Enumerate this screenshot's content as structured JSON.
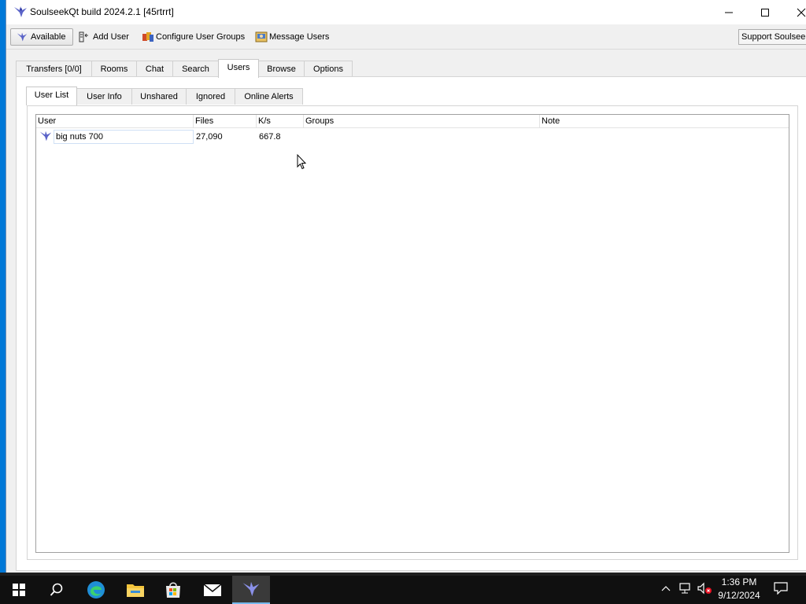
{
  "window": {
    "title": "SoulseekQt build 2024.2.1 [45rtrrt]"
  },
  "toolbar": {
    "status_label": "Available",
    "add_user_label": "Add User",
    "configure_groups_label": "Configure User Groups",
    "message_users_label": "Message Users",
    "support_label": "Support Soulseek"
  },
  "main_tabs": [
    {
      "label": "Transfers [0/0]"
    },
    {
      "label": "Rooms"
    },
    {
      "label": "Chat"
    },
    {
      "label": "Search"
    },
    {
      "label": "Users"
    },
    {
      "label": "Browse"
    },
    {
      "label": "Options"
    }
  ],
  "main_tabs_selected": "Users",
  "sub_tabs": [
    {
      "label": "User List"
    },
    {
      "label": "User Info"
    },
    {
      "label": "Unshared"
    },
    {
      "label": "Ignored"
    },
    {
      "label": "Online Alerts"
    }
  ],
  "sub_tabs_selected": "User List",
  "user_list": {
    "columns": [
      "User",
      "Files",
      "K/s",
      "Groups",
      "Note"
    ],
    "rows": [
      {
        "user": "big nuts 700",
        "files": "27,090",
        "speed": "667.8",
        "groups": "",
        "note": ""
      }
    ]
  },
  "taskbar": {
    "time": "1:36 PM",
    "date": "9/12/2024",
    "apps": [
      "windows-start",
      "search",
      "edge",
      "file-explorer",
      "microsoft-store",
      "mail",
      "soulseek"
    ],
    "active_app": "soulseek"
  },
  "colors": {
    "desktop": "#0078d7",
    "taskbar": "#101010",
    "window_bg": "#f0f0f0",
    "accent_blue": "#4a6fd8"
  }
}
